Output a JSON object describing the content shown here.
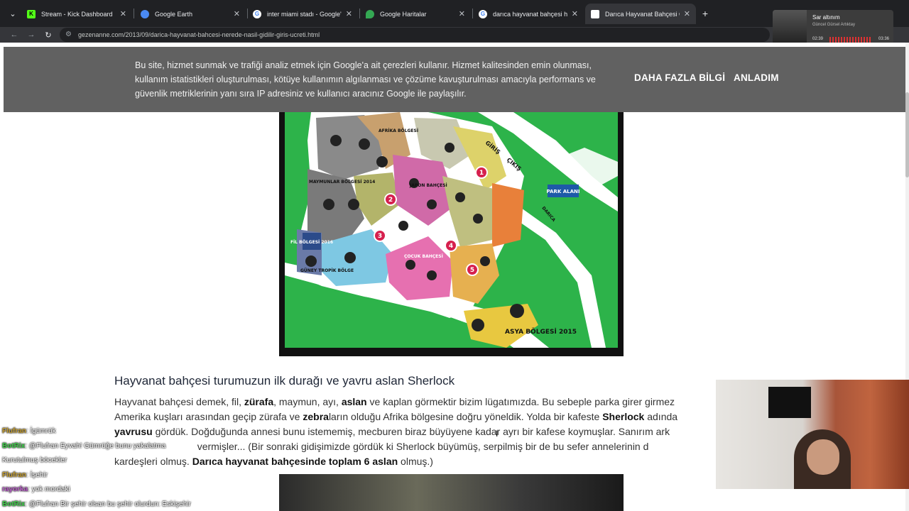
{
  "tabs": [
    {
      "title": "Stream - Kick Dashboard",
      "icon": "kick-icon",
      "color": "#53fc18"
    },
    {
      "title": "Google Earth",
      "icon": "google-earth-icon",
      "color": "#4a8af4"
    },
    {
      "title": "inter miami stadı - Google'da A",
      "icon": "google-icon",
      "color": "#ffffff"
    },
    {
      "title": "Google Haritalar",
      "icon": "google-maps-icon",
      "color": "#34a853"
    },
    {
      "title": "darıca hayvanat bahçesi harita",
      "icon": "google-icon",
      "color": "#ffffff"
    },
    {
      "title": "Darıca Hayvanat Bahçesi Gezim",
      "icon": "page-icon",
      "color": "#ffffff"
    }
  ],
  "address_bar": {
    "url": "gezenanne.com/2013/09/darica-hayvanat-bahcesi-nerede-nasil-gidilir-giris-ucreti.html"
  },
  "media": {
    "title": "Sar altınım",
    "artist": "Güncel Gürsel Artıktay",
    "elapsed": "02:39",
    "total": "03:36"
  },
  "cookie_banner": {
    "message": "Bu site, hizmet sunmak ve trafiği analiz etmek için Google'a ait çerezleri kullanır. Hizmet kalitesinden emin olunması, kullanım istatistikleri oluşturulması, kötüye kullanımın algılanması ve çözüme kavuşturulması amacıyla performans ve güvenlik metriklerinin yanı sıra IP adresiniz ve kullanıcı aracınız Google ile paylaşılır.",
    "more_info": "DAHA FAZLA BİLGİ",
    "accept": "ANLADIM"
  },
  "zoo_map": {
    "labels": {
      "africa": "AFRİKA BÖLGESİ",
      "monkeys": "MAYMUNLAR BÖLGESİ 2014",
      "elephant": "FİL BÖLGESİ 2016",
      "asia": "ASYA BÖLGESİ 2015",
      "park": "PARK ALANI",
      "entrance": "GİRİŞ",
      "exit": "ÇIKIŞ",
      "road": "DARICA",
      "japan": "JAPON BAHÇESİ",
      "south_tropic": "GÜNEY TROPİK BÖLGE",
      "children": "ÇOCUK BAHÇESİ"
    },
    "numbers": [
      "1",
      "2",
      "3",
      "4",
      "5"
    ]
  },
  "article": {
    "heading": "Hayvanat bahçesi turumuzun ilk durağı ve yavru aslan Sherlock",
    "lines": [
      [
        {
          "t": "Hayvanat bahçesi demek, fil, "
        },
        {
          "t": "zürafa",
          "b": true
        },
        {
          "t": ", maymun, ayı, "
        },
        {
          "t": "aslan",
          "b": true
        },
        {
          "t": " ve kaplan görmektir bizim lügatımızda. Bu sebeple parka girer girmez "
        }
      ],
      [
        {
          "t": "Amerika kuşları arasından geçip zürafa ve "
        },
        {
          "t": "zebra",
          "b": true
        },
        {
          "t": "ların olduğu Afrika bölgesine doğru yöneldik. Yolda bir kafeste "
        },
        {
          "t": "Sherlock",
          "b": true
        },
        {
          "t": " adında"
        }
      ],
      [
        {
          "t": "yavrusu",
          "b": true
        },
        {
          "t": " gördük. Doğduğunda annesi bunu istememiş, mecburen biraz büyüyene kadar ayrı bir kafese koymuşlar. Sanırım ark"
        }
      ],
      [
        {
          "t": "                              vermişler... (Bir sonraki gidişimizde gördük ki Sherlock büyümüş, serpilmiş bir de bu sefer annelerinin d"
        }
      ],
      [
        {
          "t": "kardeşleri olmuş. "
        },
        {
          "t": "Darıca hayvanat bahçesinde toplam 6 aslan",
          "b": true
        },
        {
          "t": " olmuş.)"
        }
      ]
    ]
  },
  "chat": [
    {
      "user": "Flufran",
      "msg": ": İgümrük",
      "cls": "u1"
    },
    {
      "user": "BotRix",
      "msg": ": @Flufran Eyvah! Gümrüğe bunu yakalatma",
      "cls": "u2"
    },
    {
      "user": "",
      "msg": "Kurutulmuş böcekler",
      "cls": ""
    },
    {
      "user": "Flufran",
      "msg": ": İşehir",
      "cls": "u1"
    },
    {
      "user": "rayorka",
      "msg": ": yok mordaki",
      "cls": "u3"
    },
    {
      "user": "BotRix",
      "msg": ": @Flufran Bir şehir olsan bu şehir olurdun: Eskişehir",
      "cls": "u2"
    }
  ]
}
